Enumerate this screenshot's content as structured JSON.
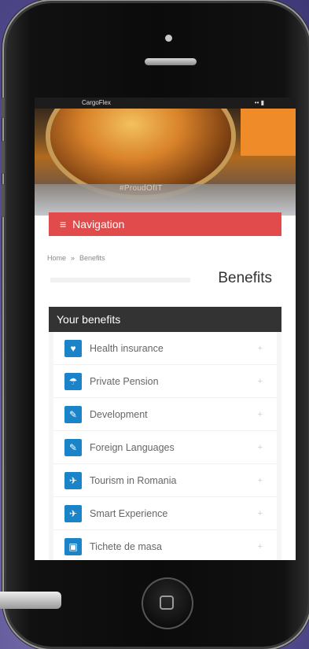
{
  "statusbar": {
    "left": "CargoFlex",
    "right": "•• ▮"
  },
  "hero": {
    "caption": "#ProudOfIT"
  },
  "navbar": {
    "icon": "hamburger-icon",
    "label": "Navigation"
  },
  "breadcrumb": {
    "home": "Home",
    "separator": "»",
    "current": "Benefits"
  },
  "page": {
    "title": "Benefits"
  },
  "card": {
    "header": "Your benefits"
  },
  "benefits": [
    {
      "label": "Health insurance",
      "icon": "heart-icon",
      "glyph": "♥"
    },
    {
      "label": "Private Pension",
      "icon": "umbrella-icon",
      "glyph": "☂"
    },
    {
      "label": "Development",
      "icon": "pencil-icon",
      "glyph": "✎"
    },
    {
      "label": "Foreign Languages",
      "icon": "pencil-icon",
      "glyph": "✎"
    },
    {
      "label": "Tourism in Romania",
      "icon": "plane-icon",
      "glyph": "✈"
    },
    {
      "label": "Smart Experience",
      "icon": "plane-icon",
      "glyph": "✈"
    },
    {
      "label": "Tichete de masa",
      "icon": "basket-icon",
      "glyph": "▣"
    }
  ],
  "colors": {
    "nav": "#e24b4b",
    "header": "#333333",
    "icon": "#1b84c9"
  }
}
